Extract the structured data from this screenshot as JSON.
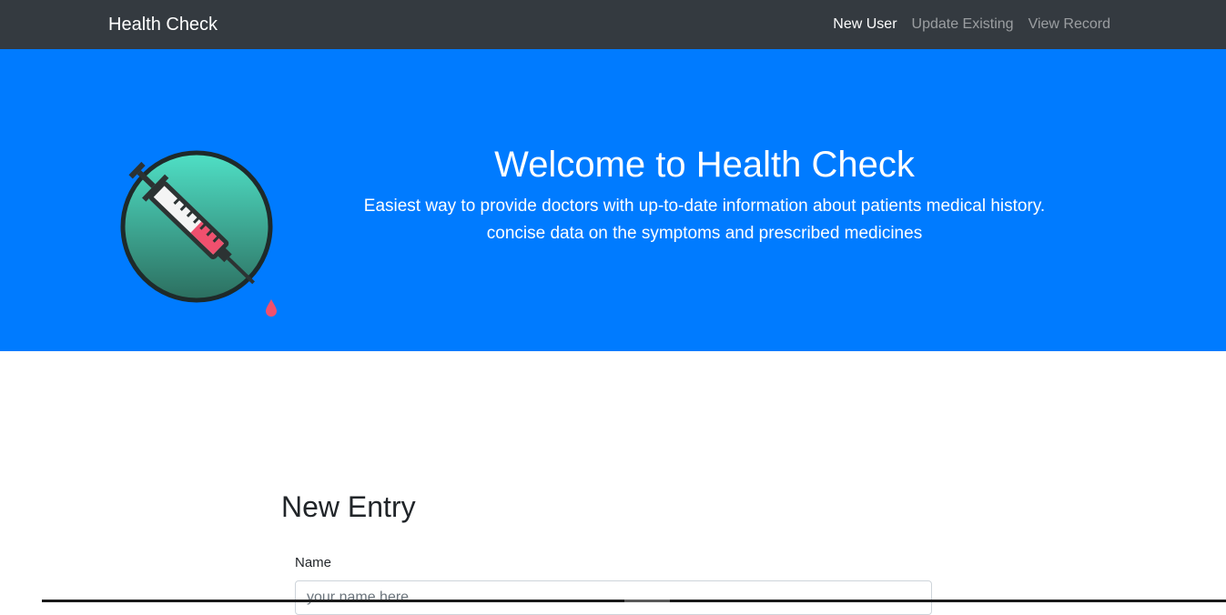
{
  "navbar": {
    "brand": "Health Check",
    "links": [
      {
        "label": "New User",
        "active": true
      },
      {
        "label": "Update Existing",
        "active": false
      },
      {
        "label": "View Record",
        "active": false
      }
    ],
    "background": "#343a40"
  },
  "hero": {
    "title": "Welcome to Health Check",
    "lead_line1": "Easiest way to provide doctors with up-to-date information about patients medical history.",
    "lead_line2": "concise data on the symptoms and prescribed medicines",
    "logo_icon": "syringe-icon",
    "background": "#007bff"
  },
  "form": {
    "title": "New Entry",
    "name_label": "Name",
    "name_placeholder": "your name here",
    "name_value": ""
  },
  "colors": {
    "accent": "#007bff",
    "syringe_fluid": "#f0506e",
    "logo_circle_top": "#4fe0c6",
    "logo_circle_bottom": "#2c6e5f"
  }
}
